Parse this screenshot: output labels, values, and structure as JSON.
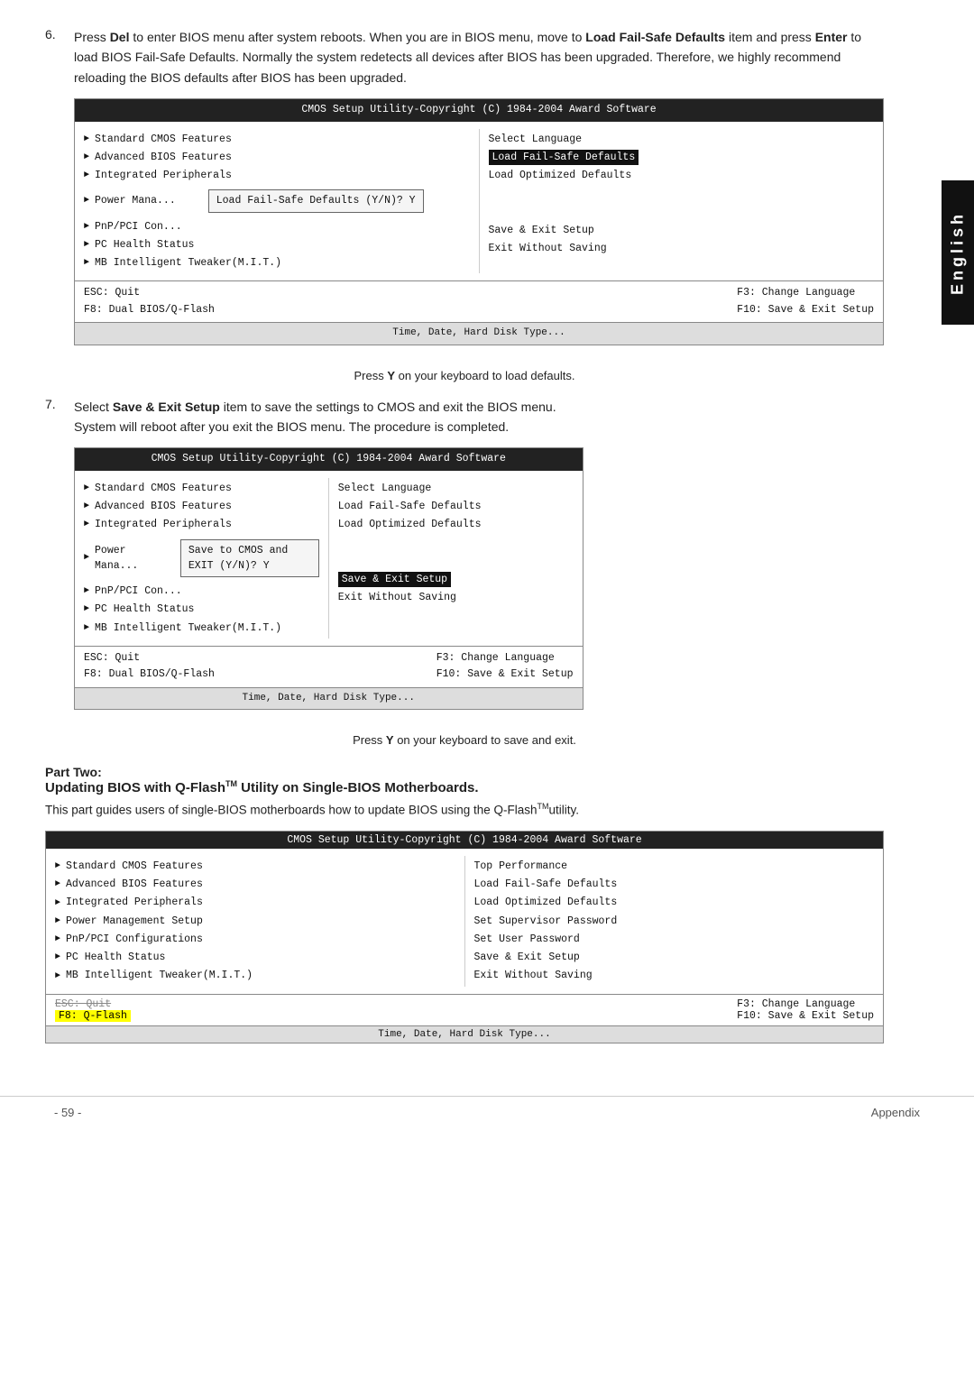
{
  "english_tab": "English",
  "step6": {
    "number": "6.",
    "text_before": "Press ",
    "del_key": "Del",
    "text1": " to enter BIOS menu after system reboots. When you are in BIOS menu, move to ",
    "load_item": "Load Fail-Safe Defaults",
    "text2": " item and press ",
    "enter_key": "Enter",
    "text3": " to load BIOS Fail-Safe Defaults. Normally the system redetects all devices after BIOS has been upgraded. Therefore, we highly recommend reloading the BIOS defaults after BIOS has been upgraded."
  },
  "bios1": {
    "title": "CMOS Setup Utility-Copyright (C) 1984-2004 Award Software",
    "left_items": [
      "Standard CMOS Features",
      "Advanced BIOS Features",
      "Integrated Peripherals",
      "Power Mana...",
      "PnP/PCI Con...",
      "PC Health Status",
      "MB Intelligent Tweaker(M.I.T.)"
    ],
    "right_items": [
      "Select Language",
      "Load Fail-Safe Defaults",
      "Load Optimized Defaults",
      "",
      "",
      "Save & Exit Setup",
      "Exit Without Saving"
    ],
    "dialog": "Load Fail-Safe Defaults (Y/N)? Y",
    "highlight_right": "Load Fail-Safe Defaults",
    "footer_left1": "ESC: Quit",
    "footer_left2": "F8: Dual BIOS/Q-Flash",
    "footer_right1": "F3: Change Language",
    "footer_right2": "F10: Save & Exit Setup",
    "bottom": "Time, Date, Hard Disk Type..."
  },
  "caption1": {
    "press": "Press ",
    "key": "Y",
    "text": " on your keyboard to load defaults."
  },
  "step7": {
    "number": "7.",
    "select": "Select ",
    "item": "Save & Exit Setup",
    "text1": " item to save the settings to CMOS and exit the BIOS menu.",
    "text2": "System will reboot after you exit the BIOS menu. The procedure is completed."
  },
  "bios2": {
    "title": "CMOS Setup Utility-Copyright (C) 1984-2004 Award Software",
    "left_items": [
      "Standard CMOS Features",
      "Advanced BIOS Features",
      "Integrated Peripherals",
      "Power Mana...",
      "PnP/PCI Con...",
      "PC Health Status",
      "MB Intelligent Tweaker(M.I.T.)"
    ],
    "right_items": [
      "Select Language",
      "Load Fail-Safe Defaults",
      "Load Optimized Defaults",
      "",
      "",
      "Save & Exit Setup",
      "Exit Without Saving"
    ],
    "dialog": "Save to CMOS and EXIT (Y/N)? Y",
    "highlight_right": "Save & Exit Setup",
    "footer_left1": "ESC: Quit",
    "footer_left2": "F8: Dual BIOS/Q-Flash",
    "footer_right1": "F3: Change Language",
    "footer_right2": "F10: Save & Exit Setup",
    "bottom": "Time, Date, Hard Disk Type..."
  },
  "caption2": {
    "press": "Press ",
    "key": "Y",
    "text": " on your keyboard to save and exit."
  },
  "part_two": {
    "label": "Part Two:",
    "title": "Updating BIOS with Q-Flash",
    "tm": "TM",
    "title2": " Utility on Single-BIOS Motherboards.",
    "desc": "This part guides users of single-BIOS motherboards how to update BIOS using the Q-Flash",
    "desc_tm": "TM",
    "desc2": "utility."
  },
  "bios3": {
    "title": "CMOS Setup Utility-Copyright (C) 1984-2004 Award Software",
    "left_items": [
      "Standard CMOS Features",
      "Advanced BIOS Features",
      "Integrated Peripherals",
      "Power Management Setup",
      "PnP/PCI Configurations",
      "PC Health Status",
      "MB Intelligent Tweaker(M.I.T.)"
    ],
    "right_items": [
      "Top Performance",
      "Load Fail-Safe Defaults",
      "Load Optimized Defaults",
      "Set Supervisor Password",
      "Set User Password",
      "Save & Exit Setup",
      "Exit Without Saving"
    ],
    "footer_left1": "ESC: Quit",
    "footer_left1_strike": true,
    "footer_left2": "F8: Q-Flash",
    "footer_left2_highlight": true,
    "footer_right1": "F3: Change Language",
    "footer_right2": "F10: Save & Exit Setup",
    "bottom": "Time, Date, Hard Disk Type..."
  },
  "page_number": "- 59 -",
  "page_label": "Appendix"
}
